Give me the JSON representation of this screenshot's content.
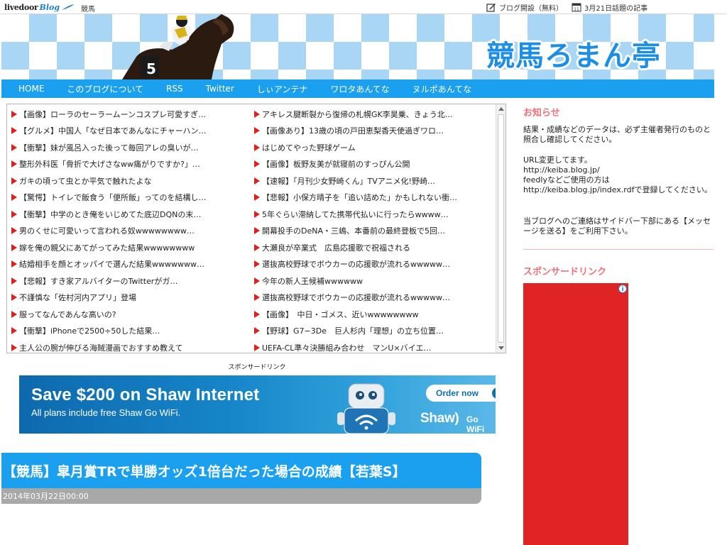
{
  "topbar": {
    "logo_text": "livedoor",
    "logo_blog": "Blog",
    "category": "競馬",
    "create_blog": "ブログ開設（無料）",
    "calendar_day": "11",
    "topic_link": "3月21日話題の記事"
  },
  "header": {
    "blog_title": "競馬ろまん亭",
    "horse_number": "5"
  },
  "nav": {
    "items": [
      "HOME",
      "このブログについて",
      "RSS",
      "Twitter",
      "しぃアンテナ",
      "ワロタあんてな",
      "ヌルポあんてな"
    ]
  },
  "headlines": {
    "left": [
      "【画像】ローラのセーラームーンコスプレ可愛すぎ…",
      "【グルメ】中国人「なぜ日本であんなにチャーハン…",
      "【衝撃】妹が風呂入った後って毎回アレの臭いが…",
      "整形外科医「骨折で大げさなww痛がりですか?」…",
      "ガキの頃って虫とか平気で触れたよな",
      "【驚愕】トイレで飯食う「便所飯」ってのを結構し…",
      "【衝撃】中学のとき俺をいじめてた底辺DQNの末…",
      "男のくせに可愛いって言われる奴wwwwwwww…",
      "嫁を俺の親父にあてがってみた結果wwwwwwww",
      "結婚相手を顔とオッパイで選んだ結果wwwwwww…",
      "【悲報】すき家アルバイターのTwitterがガ…",
      "不謹慎な「佐村河内アプリ」登場",
      "服ってなんであんな高いの?",
      "【衝撃】iPhoneで2500÷50した結果…",
      "主人公の腕が伸びる海賊漫画でおすすめ教えて"
    ],
    "right": [
      "アキレス腱断裂から復帰の札幌GK李昊乗、きょう北…",
      "【画像あり】13歳の頃の戸田恵梨香天使過ぎワロ…",
      "はじめてやった野球ゲーム",
      "【画像】板野友美が就寝前のすっぴん公開",
      "【速報】「月刊少女野崎くん」TVアニメ化!野崎…",
      "【悲報】小保方晴子を「追い詰めた」かもしれない衝…",
      "5年ぐらい滞納してた携帯代払いに行ったらwwww…",
      "開幕投手のDeNA・三嶋、本番前の最終登板で5回…",
      "大瀬良が卒業式　広島応援歌で祝福される",
      "選抜高校野球でボウカーの応援歌が流れるwwwww…",
      "今年の新人王候補wwwwww",
      "選抜高校野球でボウカーの応援歌が流れるwwwww…",
      "【画像】　中日・ゴメス、近いwwwwwwww",
      "【野球】G7−3De　巨人杉内「理想」の立ち位置…",
      "UEFA-CL準々決勝組み合わせ　マンU×バイエ…"
    ]
  },
  "sponsor": {
    "label": "スポンサードリンク"
  },
  "banner": {
    "title": "Save $200 on Shaw Internet",
    "subtitle": "All plans include free Shaw Go WiFi.",
    "order_label": "Order now",
    "brand": "Shaw)",
    "brand_suffix": "Go WiFi"
  },
  "article": {
    "title": "【競馬】皐月賞TRで単勝オッズ1倍台だった場合の成績【若葉S】",
    "date": "2014年03月22日00:00"
  },
  "sidebar": {
    "notice_heading": "お知らせ",
    "notice_line1": "結果・成績などのデータは、必ず主催者発行のものと照合し確認してください。",
    "notice_line2": "URL変更してます。",
    "notice_line3": "http://keiba.blog.jp/",
    "notice_line4": "feedlyなどご使用の方は",
    "notice_line5": "http://keiba.blog.jp/index.rdfで登録してください。",
    "notice_line6": "当ブログへのご連絡はサイドバー下部にある【メッセージを送る】をご利用下さい。",
    "sponsor_heading": "スポンサードリンク",
    "ad_info": "i"
  },
  "colors": {
    "accent_blue": "#1aa0ee",
    "title_blue": "#1d8ee6",
    "bullet_red": "#e01e1e",
    "sidebar_heading": "#f0707a",
    "ad_red": "#e02424"
  }
}
